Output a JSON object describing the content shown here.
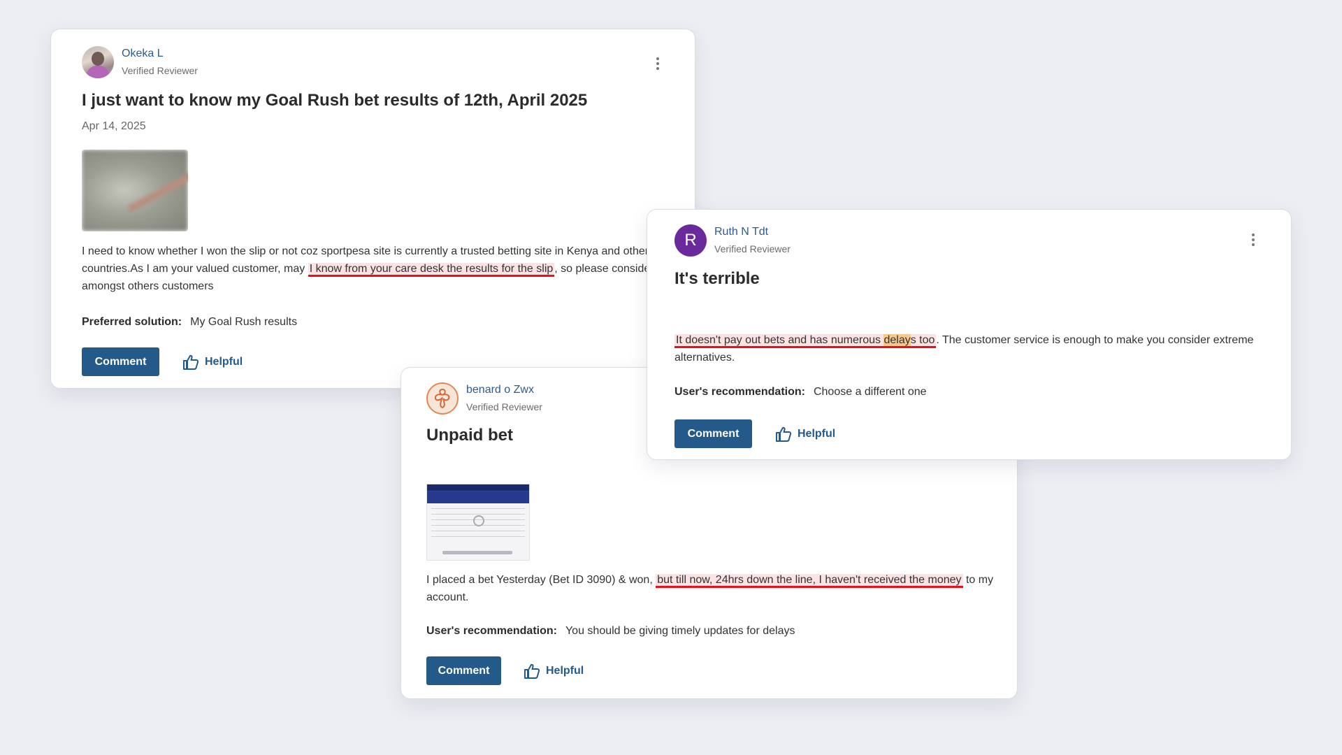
{
  "colors": {
    "accent": "#245a8a",
    "link": "#2d5a8c",
    "highlight_bg": "#fbe2e3",
    "underline": "#e5121e",
    "highlight_word": "#f6c88c",
    "avatar_letter_bg": "#6b2a9c",
    "background": "#eceef3"
  },
  "reviews": [
    {
      "name": "Okeka L",
      "tag": "Verified Reviewer",
      "avatar": "user-photo",
      "title": "I just want to know my Goal Rush bet results of 12th, April 2025",
      "date": "Apr 14, 2025",
      "body_before": "I need to know whether I won the slip or not coz sportpesa site is currently a trusted betting site in Kenya and other countries.As I am your valued customer, may ",
      "body_highlight": "I know from your care desk the results for the slip",
      "body_after": ", so please consider me amongst others customers",
      "rec_label": "Preferred solution:",
      "rec_value": "My Goal Rush results",
      "comment_label": "Comment",
      "helpful_label": "Helpful",
      "menu_icon": "kebab-menu-icon"
    },
    {
      "name": "Ruth N Tdt",
      "tag": "Verified Reviewer",
      "avatar_letter": "R",
      "title": "It's terrible",
      "body_hl_a": "It doesn't pay out bets and has numerous ",
      "body_hl_word": "delay",
      "body_hl_b": "s too",
      "body_after": ". The customer service is enough to make you consider extreme alternatives.",
      "rec_label": "User's recommendation:",
      "rec_value": "Choose a different one",
      "comment_label": "Comment",
      "helpful_label": "Helpful",
      "menu_icon": "kebab-menu-icon"
    },
    {
      "name": "benard o Zwx",
      "tag": "Verified Reviewer",
      "avatar": "logo-avatar",
      "title": "Unpaid bet",
      "body_before": "I placed a bet Yesterday (Bet ID 3090) & won, ",
      "body_highlight": "but till now, 24hrs down the line, I haven't received the money",
      "body_after": " to my account.",
      "rec_label": "User's recommendation:",
      "rec_value": "You should be giving timely updates for delays",
      "comment_label": "Comment",
      "helpful_label": "Helpful"
    }
  ]
}
